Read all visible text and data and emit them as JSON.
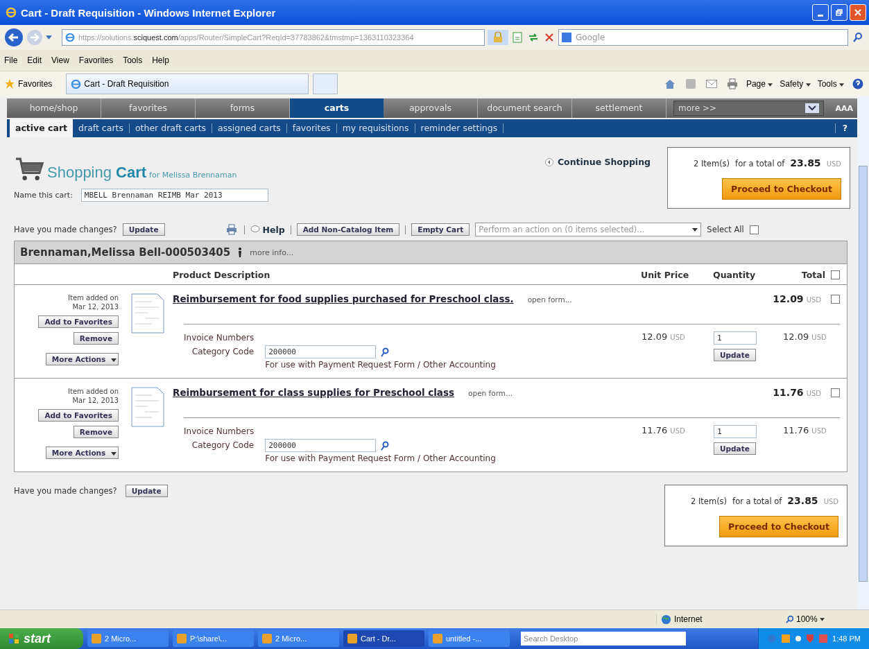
{
  "window": {
    "title": "Cart - Draft Requisition - Windows Internet Explorer"
  },
  "address_bar": {
    "url": "https://solutions.**sciquest.com**/apps/Router/SimpleCart?ReqId=37783862&tmstmp=1363110323364",
    "search_placeholder": "Google"
  },
  "menu": [
    "File",
    "Edit",
    "View",
    "Favorites",
    "Tools",
    "Help"
  ],
  "favorites_bar": {
    "favorites": "Favorites",
    "tab": "Cart - Draft Requisition",
    "commands": [
      "Page",
      "Safety",
      "Tools"
    ]
  },
  "nav": {
    "tabs": [
      {
        "label": "home/shop",
        "selected": false
      },
      {
        "label": "favorites",
        "selected": false
      },
      {
        "label": "forms",
        "selected": false
      },
      {
        "label": "carts",
        "selected": true
      },
      {
        "label": "approvals",
        "selected": false
      },
      {
        "label": "document search",
        "selected": false
      },
      {
        "label": "settlement",
        "selected": false
      }
    ],
    "more": "more >>",
    "text_size": "AAA"
  },
  "subnav": {
    "items": [
      {
        "label": "active cart",
        "selected": true
      },
      {
        "label": "draft carts",
        "selected": false
      },
      {
        "label": "other draft carts",
        "selected": false
      },
      {
        "label": "assigned carts",
        "selected": false
      },
      {
        "label": "favorites",
        "selected": false
      },
      {
        "label": "my requisitions",
        "selected": false
      },
      {
        "label": "reminder settings",
        "selected": false
      }
    ],
    "help": "?"
  },
  "cart": {
    "title_light": "Shopping",
    "title_bold": "Cart",
    "owner": "for Melissa Brennaman",
    "name_label": "Name this cart:",
    "name_value": "MBELL Brennaman REIMB Mar 2013",
    "continue": "Continue Shopping"
  },
  "summary": {
    "count": "2 Item(s)",
    "for": "for a total of",
    "total": "23.85",
    "currency": "USD",
    "checkout": "Proceed to Checkout"
  },
  "toolbar": {
    "changes": "Have you made changes?",
    "update": "Update",
    "help": "Help",
    "add_item": "Add Non-Catalog Item",
    "empty": "Empty Cart",
    "action_placeholder": "Perform an action on (0 items selected)...",
    "select_all": "Select All",
    "select_all_checked": false
  },
  "supplier": {
    "name": "Brennaman,Melissa Bell-000503405",
    "more_info": "more info..."
  },
  "columns": {
    "description": "Product Description",
    "unit_price": "Unit Price",
    "quantity": "Quantity",
    "total": "Total",
    "checked": false
  },
  "items": [
    {
      "added": "Item added on",
      "date": "Mar 12, 2013",
      "favorite": "Add to Favorites",
      "remove": "Remove",
      "more": "More Actions",
      "title": "Reimbursement for food supplies purchased for Preschool class.",
      "open_form": "open form...",
      "total": "12.09",
      "currency": "USD",
      "checked": false,
      "invoice": "Invoice Numbers",
      "category_label": "Category Code",
      "category_value": "200000",
      "hint": "For use with Payment Request Form / Other Accounting",
      "unit_price": "12.09",
      "unit_currency": "USD",
      "quantity": "1",
      "update": "Update",
      "line_total": "12.09",
      "line_currency": "USD"
    },
    {
      "added": "Item added on",
      "date": "Mar 12, 2013",
      "favorite": "Add to Favorites",
      "remove": "Remove",
      "more": "More Actions",
      "title": "Reimbursement for class supplies for Preschool class",
      "open_form": "open form...",
      "total": "11.76",
      "currency": "USD",
      "checked": false,
      "invoice": "Invoice Numbers",
      "category_label": "Category Code",
      "category_value": "200000",
      "hint": "For use with Payment Request Form / Other Accounting",
      "unit_price": "11.76",
      "unit_currency": "USD",
      "quantity": "1",
      "update": "Update",
      "line_total": "11.76",
      "line_currency": "USD"
    }
  ],
  "footer": {
    "changes": "Have you made changes?",
    "update": "Update"
  },
  "footer_summary": {
    "count": "2 Item(s)",
    "for": "for a total of",
    "total": "23.85",
    "currency": "USD",
    "checkout": "Proceed to Checkout"
  },
  "status_bar": {
    "zone": "Internet",
    "zoom": "100%"
  },
  "taskbar": {
    "start": "start",
    "tasks": [
      {
        "label": "2 Micro...",
        "selected": false
      },
      {
        "label": "P:\\share\\...",
        "selected": false
      },
      {
        "label": "2 Micro...",
        "selected": false
      },
      {
        "label": "Cart - Dr...",
        "selected": true
      },
      {
        "label": "untitled -...",
        "selected": false
      }
    ],
    "search_placeholder": "Search Desktop",
    "clock": "1:48 PM"
  }
}
